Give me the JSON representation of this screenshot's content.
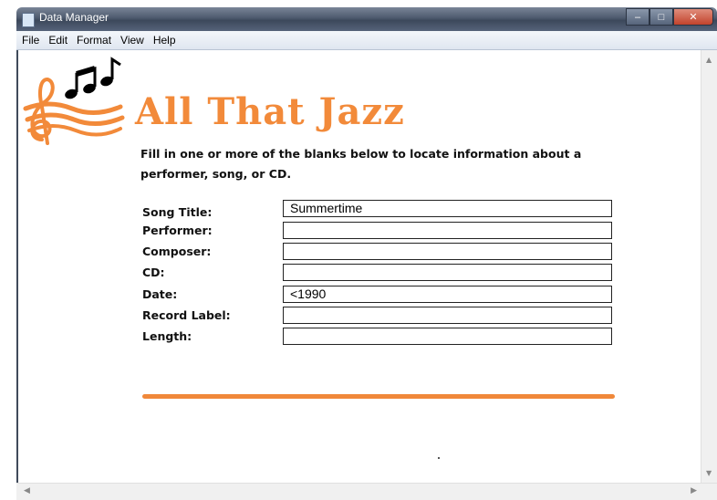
{
  "window": {
    "title": "Data Manager"
  },
  "menu": [
    "File",
    "Edit",
    "Format",
    "View",
    "Help"
  ],
  "app": {
    "heading": "All That Jazz",
    "instructions": "Fill in one or more of the blanks below to locate information about a performer, song, or CD.",
    "accent_color": "#f28a3a"
  },
  "form": {
    "fields": [
      {
        "label": "Song Title:",
        "value": "Summertime"
      },
      {
        "label": "Performer:",
        "value": ""
      },
      {
        "label": "Composer:",
        "value": ""
      },
      {
        "label": "CD:",
        "value": ""
      },
      {
        "label": "Date:",
        "value": "<1990"
      },
      {
        "label": "Record Label:",
        "value": ""
      },
      {
        "label": "Length:",
        "value": ""
      }
    ]
  },
  "icons": {
    "logo": "treble-clef-music-notes-logo",
    "window_controls": [
      "minimize-icon",
      "maximize-icon",
      "close-icon"
    ]
  }
}
